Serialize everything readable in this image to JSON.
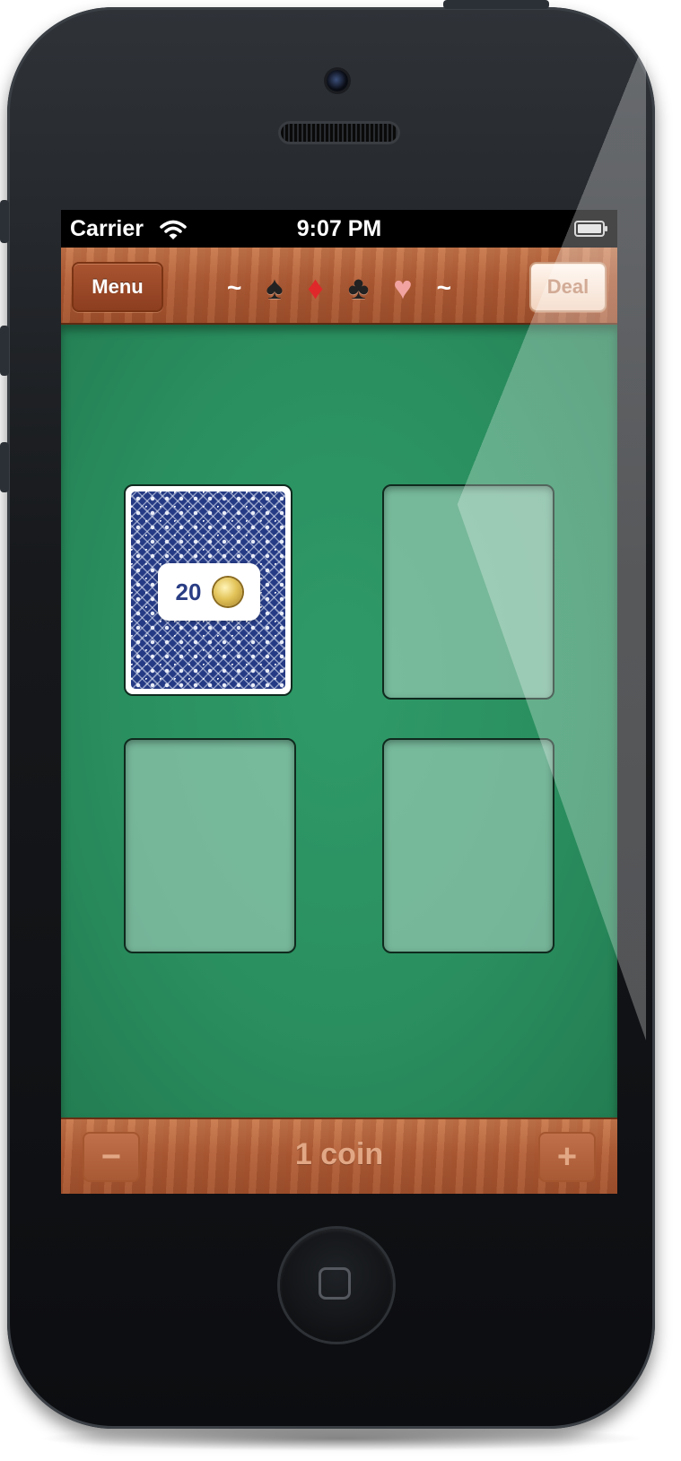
{
  "status_bar": {
    "carrier": "Carrier",
    "time": "9:07 PM",
    "wifi_icon": "wifi-icon",
    "battery_icon": "battery-icon"
  },
  "top_bar": {
    "menu_label": "Menu",
    "deal_label": "Deal",
    "suits": {
      "left_tilde": "~",
      "spade": "♠",
      "diamond": "♦",
      "club": "♣",
      "heart": "♥",
      "right_tilde": "~"
    }
  },
  "table": {
    "card_back": {
      "bet_value": "20",
      "coin_icon": "coin-icon",
      "pattern_color": "#253a84"
    },
    "empty_slots": 3,
    "felt_color": "#2a8f5f"
  },
  "bottom_bar": {
    "minus_label": "−",
    "plus_label": "+",
    "coin_count": "1 coin"
  },
  "colors": {
    "wood": "#b2603a",
    "felt": "#2a8f5f",
    "deal_text": "#c08b6d",
    "suit_diamond": "#e0282a",
    "suit_heart": "#f0a3a0"
  }
}
